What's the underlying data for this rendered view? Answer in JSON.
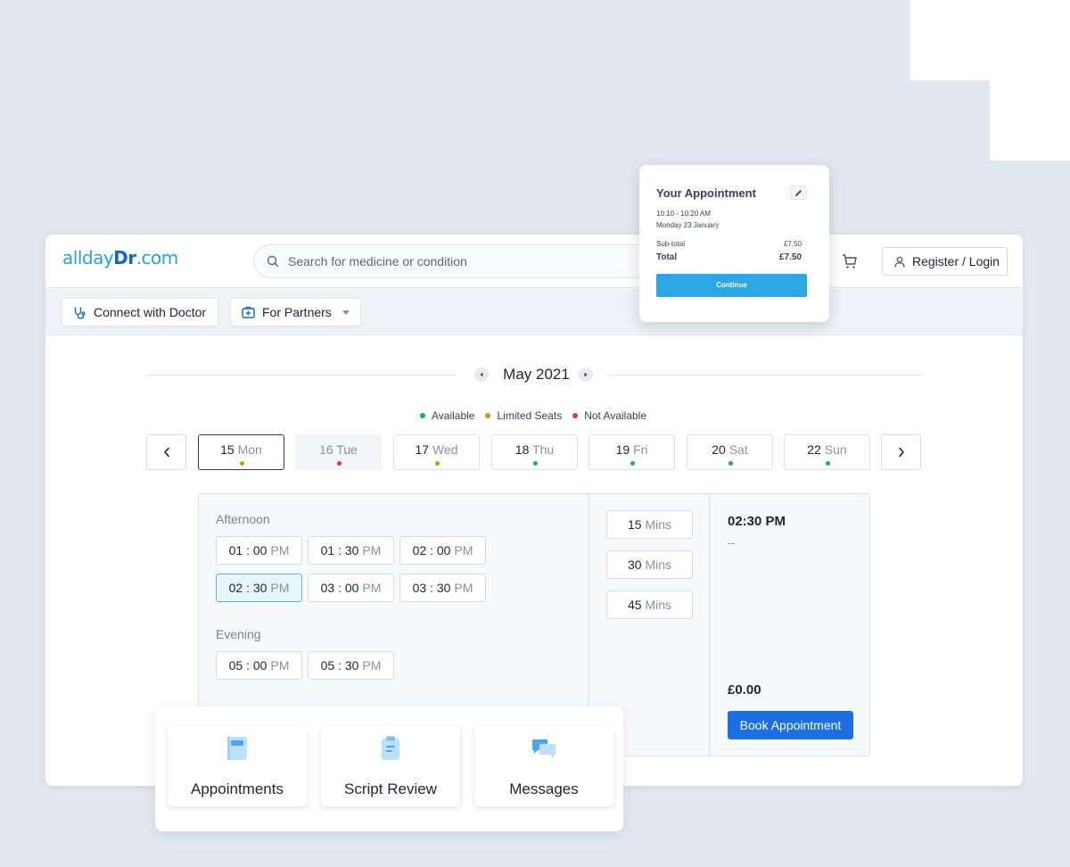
{
  "header": {
    "logo_prefix": "allday",
    "logo_bold": "Dr",
    "logo_suffix": ".com",
    "search_placeholder": "Search for medicine or condition",
    "login_label": "Register / Login"
  },
  "subnav": {
    "connect_label": "Connect with Doctor",
    "partners_label": "For Partners"
  },
  "calendar": {
    "month": "May 2021",
    "legend": [
      {
        "label": "Available",
        "color": "#1fab5e"
      },
      {
        "label": "Limited Seats",
        "color": "#d7920f"
      },
      {
        "label": "Not Available",
        "color": "#e03a3a"
      }
    ],
    "days": [
      {
        "num": "15",
        "name": "Mon",
        "status_color": "#d7920f",
        "selected": true,
        "disabled": false
      },
      {
        "num": "16",
        "name": "Tue",
        "status_color": "#e03a3a",
        "selected": false,
        "disabled": true
      },
      {
        "num": "17",
        "name": "Wed",
        "status_color": "#d7920f",
        "selected": false,
        "disabled": false
      },
      {
        "num": "18",
        "name": "Thu",
        "status_color": "#1fab5e",
        "selected": false,
        "disabled": false
      },
      {
        "num": "19",
        "name": "Fri",
        "status_color": "#1fab5e",
        "selected": false,
        "disabled": false
      },
      {
        "num": "20",
        "name": "Sat",
        "status_color": "#1fab5e",
        "selected": false,
        "disabled": false
      },
      {
        "num": "22",
        "name": "Sun",
        "status_color": "#1fab5e",
        "selected": false,
        "disabled": false
      }
    ]
  },
  "slots": {
    "afternoon_label": "Afternoon",
    "evening_label": "Evening",
    "afternoon": [
      {
        "time": "01 : 00",
        "ampm": "PM"
      },
      {
        "time": "01 : 30",
        "ampm": "PM"
      },
      {
        "time": "02 : 00",
        "ampm": "PM"
      },
      {
        "time": "02 : 30",
        "ampm": "PM"
      },
      {
        "time": "03 : 00",
        "ampm": "PM"
      },
      {
        "time": "03 : 30",
        "ampm": "PM"
      }
    ],
    "evening": [
      {
        "time": "05 : 00",
        "ampm": "PM"
      },
      {
        "time": "05 : 30",
        "ampm": "PM"
      }
    ],
    "selected_afternoon_index": 3
  },
  "durations": [
    {
      "value": "15",
      "unit": "Mins"
    },
    {
      "value": "30",
      "unit": "Mins"
    },
    {
      "value": "45",
      "unit": "Mins"
    }
  ],
  "summary": {
    "time": "02:30 PM",
    "dash": "--",
    "price": "£0.00",
    "book_label": "Book Appointment"
  },
  "cards": [
    {
      "label": "Appointments",
      "icon": "notebook-icon"
    },
    {
      "label": "Script Review",
      "icon": "clipboard-icon"
    },
    {
      "label": "Messages",
      "icon": "chat-bubbles-icon"
    }
  ],
  "popup": {
    "title": "Your Appointment",
    "time_range": "10:10 - 10:20 AM",
    "date": "Monday 23 January",
    "subtotal_label": "Sub-total",
    "subtotal_value": "£7.50",
    "total_label": "Total",
    "total_value": "£7.50",
    "continue_label": "Continue"
  }
}
